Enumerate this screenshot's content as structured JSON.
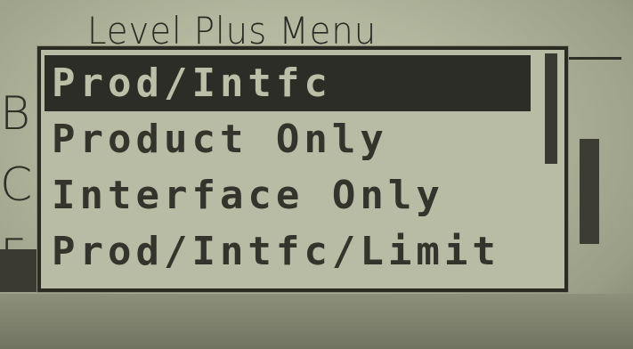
{
  "screen": {
    "title": "Level Plus Menu",
    "background_letters": [
      "B",
      "C",
      "F"
    ]
  },
  "menu": {
    "items": [
      {
        "label": "Prod/Intfc",
        "selected": true
      },
      {
        "label": "Product Only",
        "selected": false
      },
      {
        "label": "Interface Only",
        "selected": false
      },
      {
        "label": "Prod/Intfc/Limit",
        "selected": false
      }
    ]
  },
  "colors": {
    "lcd_background": "#b9bca4",
    "pixel_dark": "#2d2d27",
    "selection_text": "#bcbfa8"
  }
}
